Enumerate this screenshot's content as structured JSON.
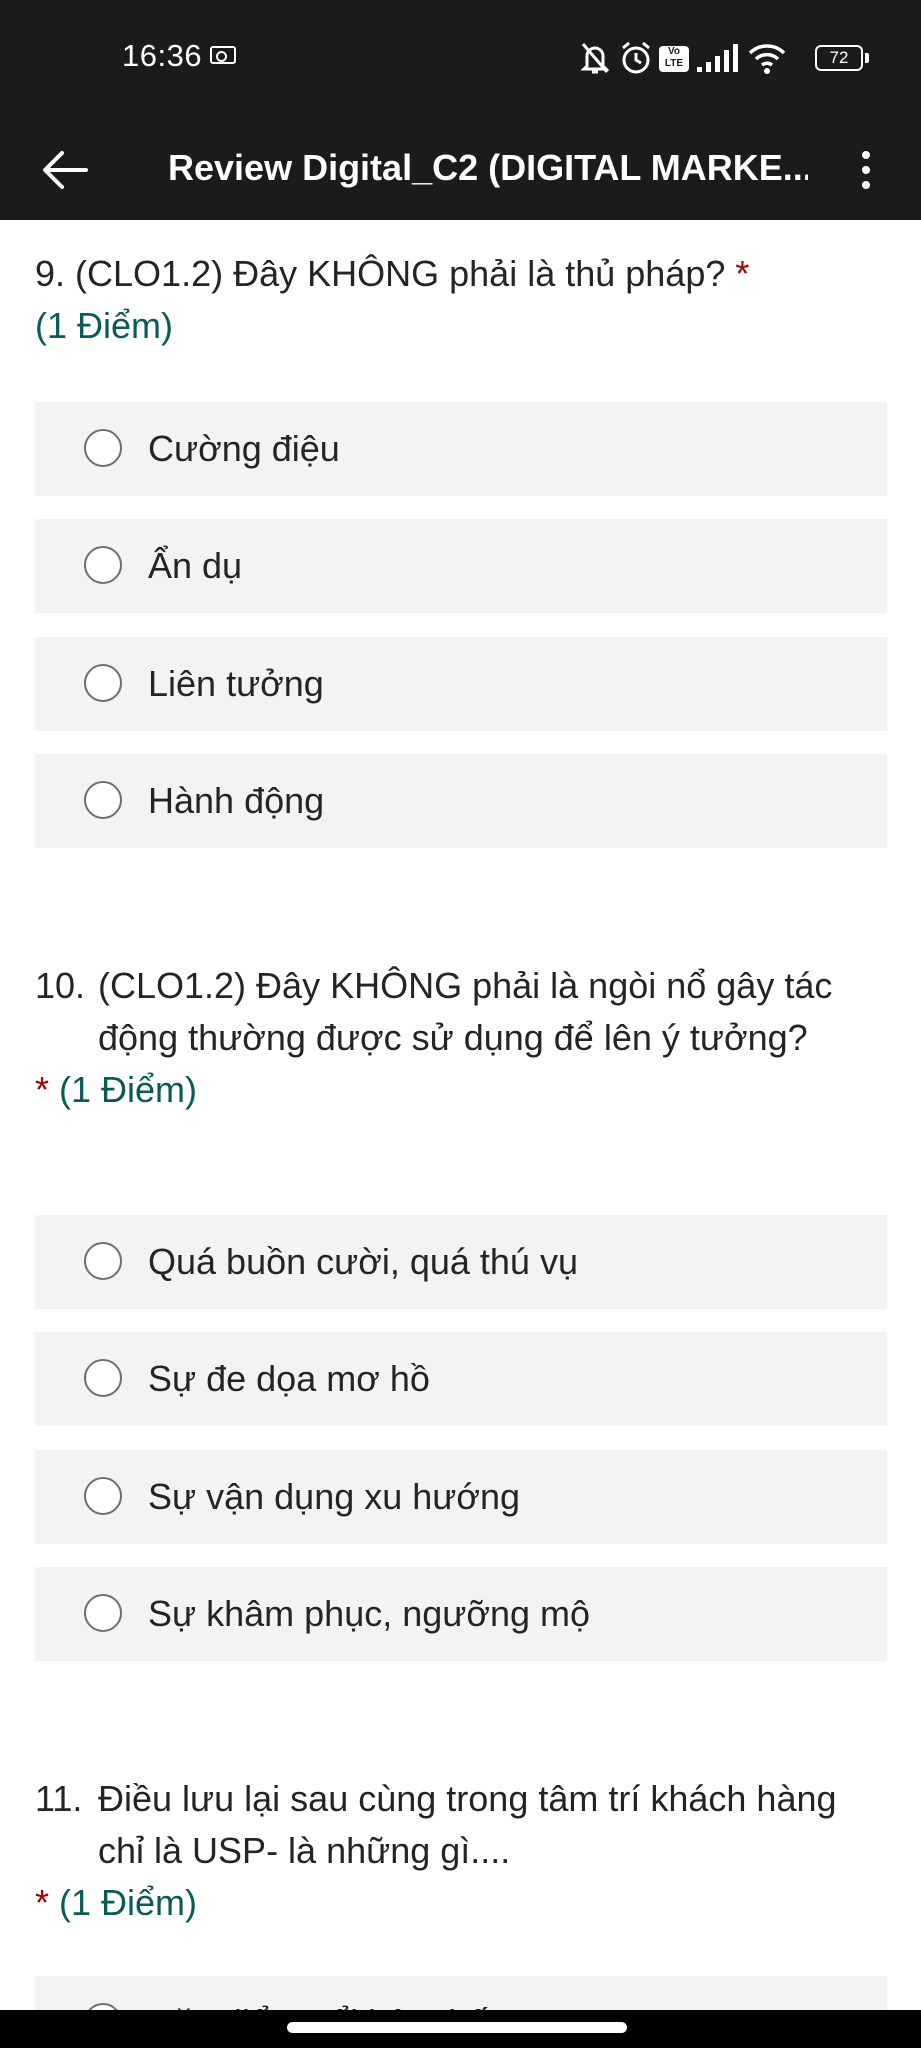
{
  "status_bar": {
    "time": "16:36",
    "battery": "72",
    "volte": "Vo LTE",
    "icons": [
      "notification-icon",
      "bell-off-icon",
      "alarm-icon",
      "volte-icon",
      "signal-icon",
      "wifi-icon",
      "battery-icon"
    ]
  },
  "app_bar": {
    "title": "Review Digital_C2 (DIGITAL MARKE...",
    "back_icon": "arrow-left-icon",
    "more_icon": "more-vertical-icon"
  },
  "questions": [
    {
      "number": "9.",
      "text": "(CLO1.2) Đây KHÔNG phải là thủ pháp?",
      "required_mark": "*",
      "points": "(1 Điểm)",
      "options": [
        "Cường điệu",
        "Ẩn dụ",
        "Liên tưởng",
        "Hành động"
      ]
    },
    {
      "number": "10.",
      "text": "(CLO1.2) Đây KHÔNG phải là ngòi nổ gây tác động thường được sử dụng để lên ý tưởng?",
      "required_mark": "*",
      "points": "(1 Điểm)",
      "options": [
        "Quá buồn cười, quá thú vụ",
        "Sự đe dọa mơ hồ",
        "Sự vận dụng xu hướng",
        "Sự khâm phục, ngưỡng mộ"
      ]
    },
    {
      "number": "11.",
      "text": "Điều lưu lại sau cùng trong tâm trí khách hàng chỉ là USP- là những gì....",
      "required_mark": "*",
      "points": "(1 Điểm)",
      "options": [
        "Đặc điểm nổi bật nhất"
      ]
    }
  ],
  "colors": {
    "bar_background": "#1b1b1b",
    "option_background": "#f3f3f3",
    "required": "#a80000",
    "points": "#0a5a5a"
  }
}
